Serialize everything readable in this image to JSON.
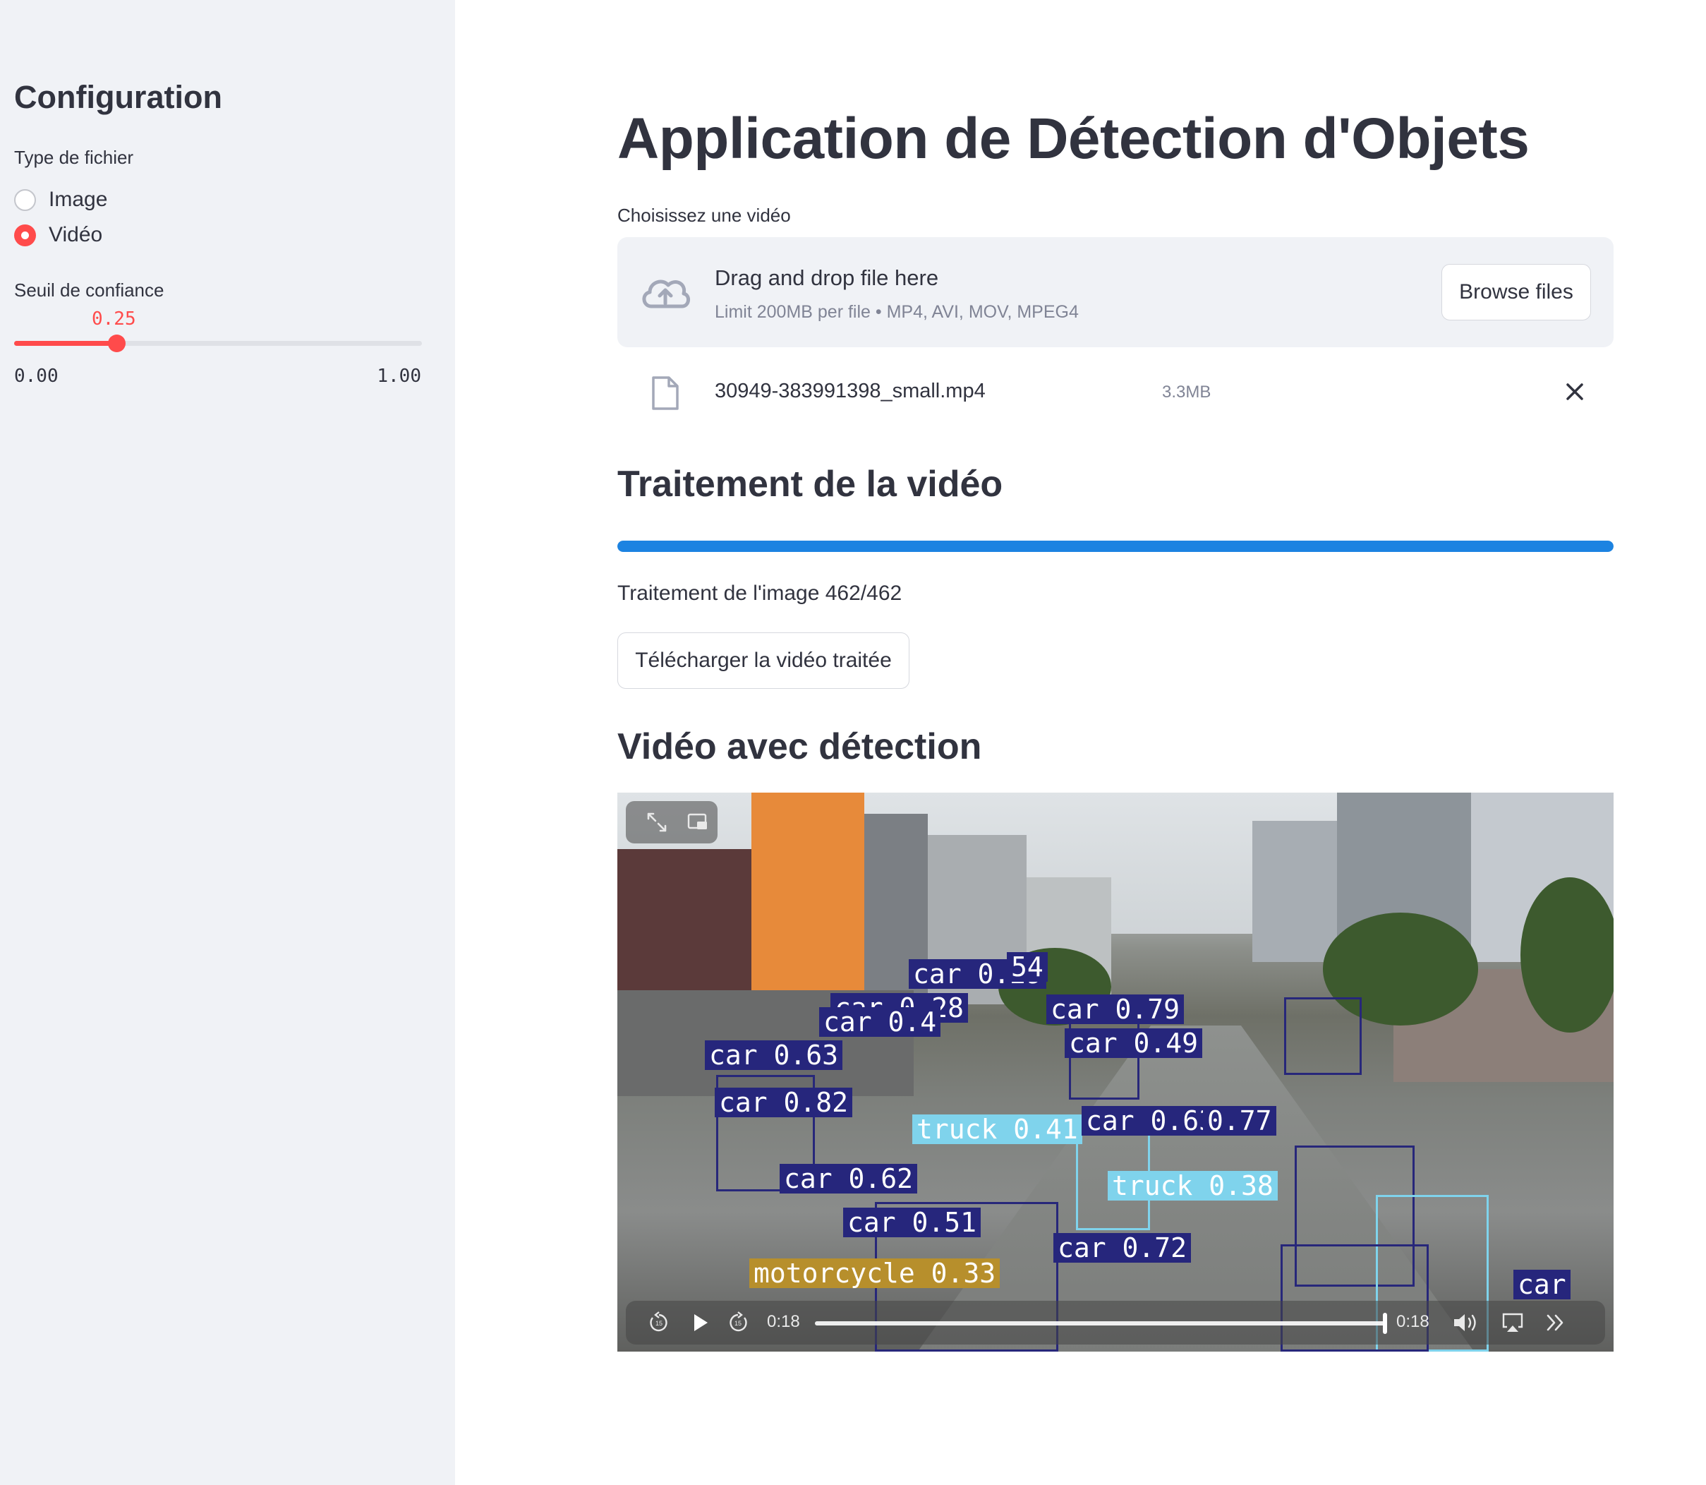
{
  "sidebar": {
    "title": "Configuration",
    "file_type_label": "Type de fichier",
    "options": [
      {
        "label": "Image",
        "selected": false
      },
      {
        "label": "Vidéo",
        "selected": true
      }
    ],
    "slider": {
      "label": "Seuil de confiance",
      "value_text": "0.25",
      "value": 0.25,
      "min_text": "0.00",
      "max_text": "1.00",
      "accent": "#ff4b4b"
    }
  },
  "main": {
    "title": "Application de Détection d'Objets",
    "uploader": {
      "label": "Choisissez une vidéo",
      "drop_text": "Drag and drop file here",
      "limit_text": "Limit 200MB per file • MP4, AVI, MOV, MPEG4",
      "browse_label": "Browse files",
      "file_name": "30949-383991398_small.mp4",
      "file_size": "3.3MB"
    },
    "processing": {
      "heading": "Traitement de la vidéo",
      "progress": 1.0,
      "progress_color": "#1c83e1",
      "status_text": "Traitement de l'image 462/462",
      "download_label": "Télécharger la vidéo traitée"
    },
    "video_section": {
      "heading": "Vidéo avec détection",
      "current_time": "0:18",
      "duration": "0:18",
      "progress": 1.0,
      "detections": [
        {
          "label": "car 0.29",
          "cls": "car"
        },
        {
          "label": "54",
          "cls": "car"
        },
        {
          "label": "car 0.28",
          "cls": "car"
        },
        {
          "label": "car 0.4",
          "cls": "car"
        },
        {
          "label": "car 0.63",
          "cls": "car"
        },
        {
          "label": "car 0.82",
          "cls": "car"
        },
        {
          "label": "car 0.79",
          "cls": "car"
        },
        {
          "label": "car 0.49",
          "cls": "car"
        },
        {
          "label": "truck 0.41",
          "cls": "truck"
        },
        {
          "label": "car 0.62",
          "cls": "car"
        },
        {
          "label": "car 0.51",
          "cls": "car"
        },
        {
          "label": "car 0.63",
          "cls": "car"
        },
        {
          "label": "0.77",
          "cls": "car"
        },
        {
          "label": "truck 0.38",
          "cls": "truck"
        },
        {
          "label": "car 0.72",
          "cls": "car"
        },
        {
          "label": "motorcycle 0.33",
          "cls": "moto"
        },
        {
          "label": "car",
          "cls": "car"
        }
      ]
    }
  }
}
